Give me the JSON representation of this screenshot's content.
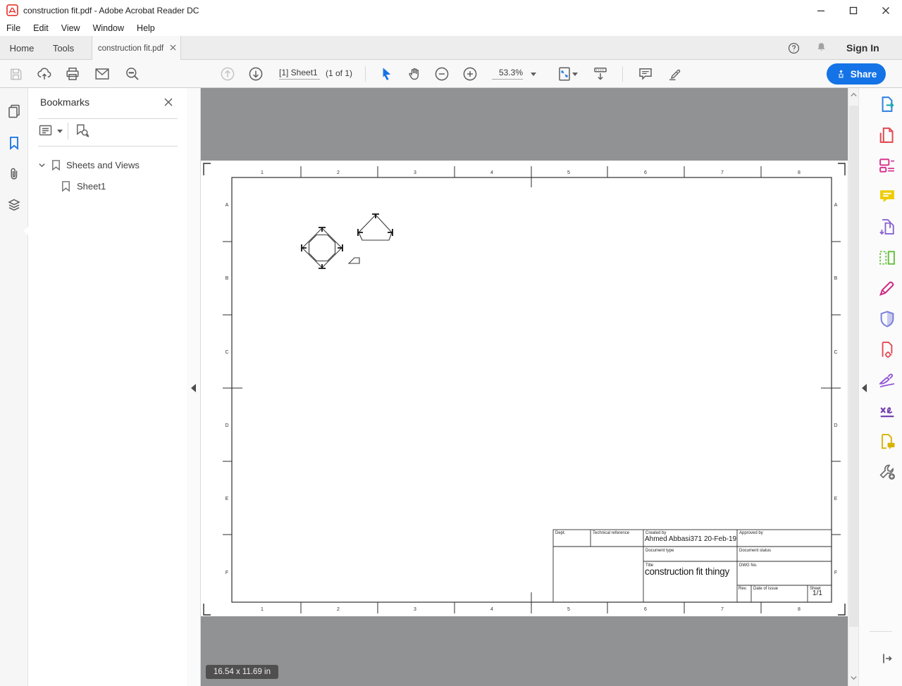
{
  "window": {
    "title": "construction fit.pdf - Adobe Acrobat Reader DC"
  },
  "menu": {
    "items": [
      "File",
      "Edit",
      "View",
      "Window",
      "Help"
    ]
  },
  "tab_bar": {
    "home": "Home",
    "tools": "Tools",
    "document_tab": "construction fit.pdf",
    "sign_in": "Sign In"
  },
  "toolbar": {
    "page_field": "[1] Sheet1",
    "page_count": "(1 of 1)",
    "zoom_level": "53.3%",
    "share_label": "Share"
  },
  "left_panel": {
    "icons": [
      "page-thumbnails",
      "bookmarks",
      "attachments",
      "layers"
    ],
    "active": "bookmarks"
  },
  "bookmarks": {
    "title": "Bookmarks",
    "items": [
      {
        "label": "Sheets and Views"
      },
      {
        "label": "Sheet1"
      }
    ]
  },
  "sheet": {
    "ruler_numbers": [
      "1",
      "2",
      "3",
      "4",
      "5",
      "6",
      "7",
      "8"
    ],
    "ruler_letters": [
      "A",
      "B",
      "C",
      "D",
      "E",
      "F"
    ],
    "title_block": {
      "dept_label": "Dept.",
      "tech_ref_label": "Technical reference",
      "created_by_label": "Created by",
      "created_by_value": "Ahmed Abbasi371 20-Feb-19",
      "approved_by_label": "Approved by",
      "doc_type_label": "Document type",
      "doc_status_label": "Document status",
      "title_label": "Title",
      "title_value": "construction fit thingy",
      "dwg_no_label": "DWG No.",
      "rev_label": "Rev.",
      "date_label": "Date of issue",
      "sheet_label": "Sheet",
      "sheet_value": "1/1"
    }
  },
  "status": {
    "dimensions": "16.54 x 11.69 in"
  },
  "right_tools": [
    {
      "name": "export-pdf",
      "color": "#2f7fe0",
      "color2": "#0fa3b1"
    },
    {
      "name": "create-pdf",
      "color": "#e34850"
    },
    {
      "name": "edit-pdf",
      "color": "#d83790"
    },
    {
      "name": "comment",
      "color": "#edcc00"
    },
    {
      "name": "combine-files",
      "color": "#8a63d2"
    },
    {
      "name": "organize-pages",
      "color": "#68c242"
    },
    {
      "name": "fill-and-sign",
      "color": "#ce2783"
    },
    {
      "name": "protect",
      "color": "#7a7fdc"
    },
    {
      "name": "compress-pdf",
      "color": "#e34850"
    },
    {
      "name": "adobe-sign",
      "color": "#9256d9"
    },
    {
      "name": "request-signatures",
      "color": "#6f38b1"
    },
    {
      "name": "send-for-comments",
      "color": "#d7b300"
    },
    {
      "name": "more-tools",
      "color": "#6e6e6e"
    }
  ],
  "colors": {
    "accent_blue": "#1473e6",
    "canvas_gray": "#909294",
    "tooltip_bg": "#4a4a4a"
  }
}
